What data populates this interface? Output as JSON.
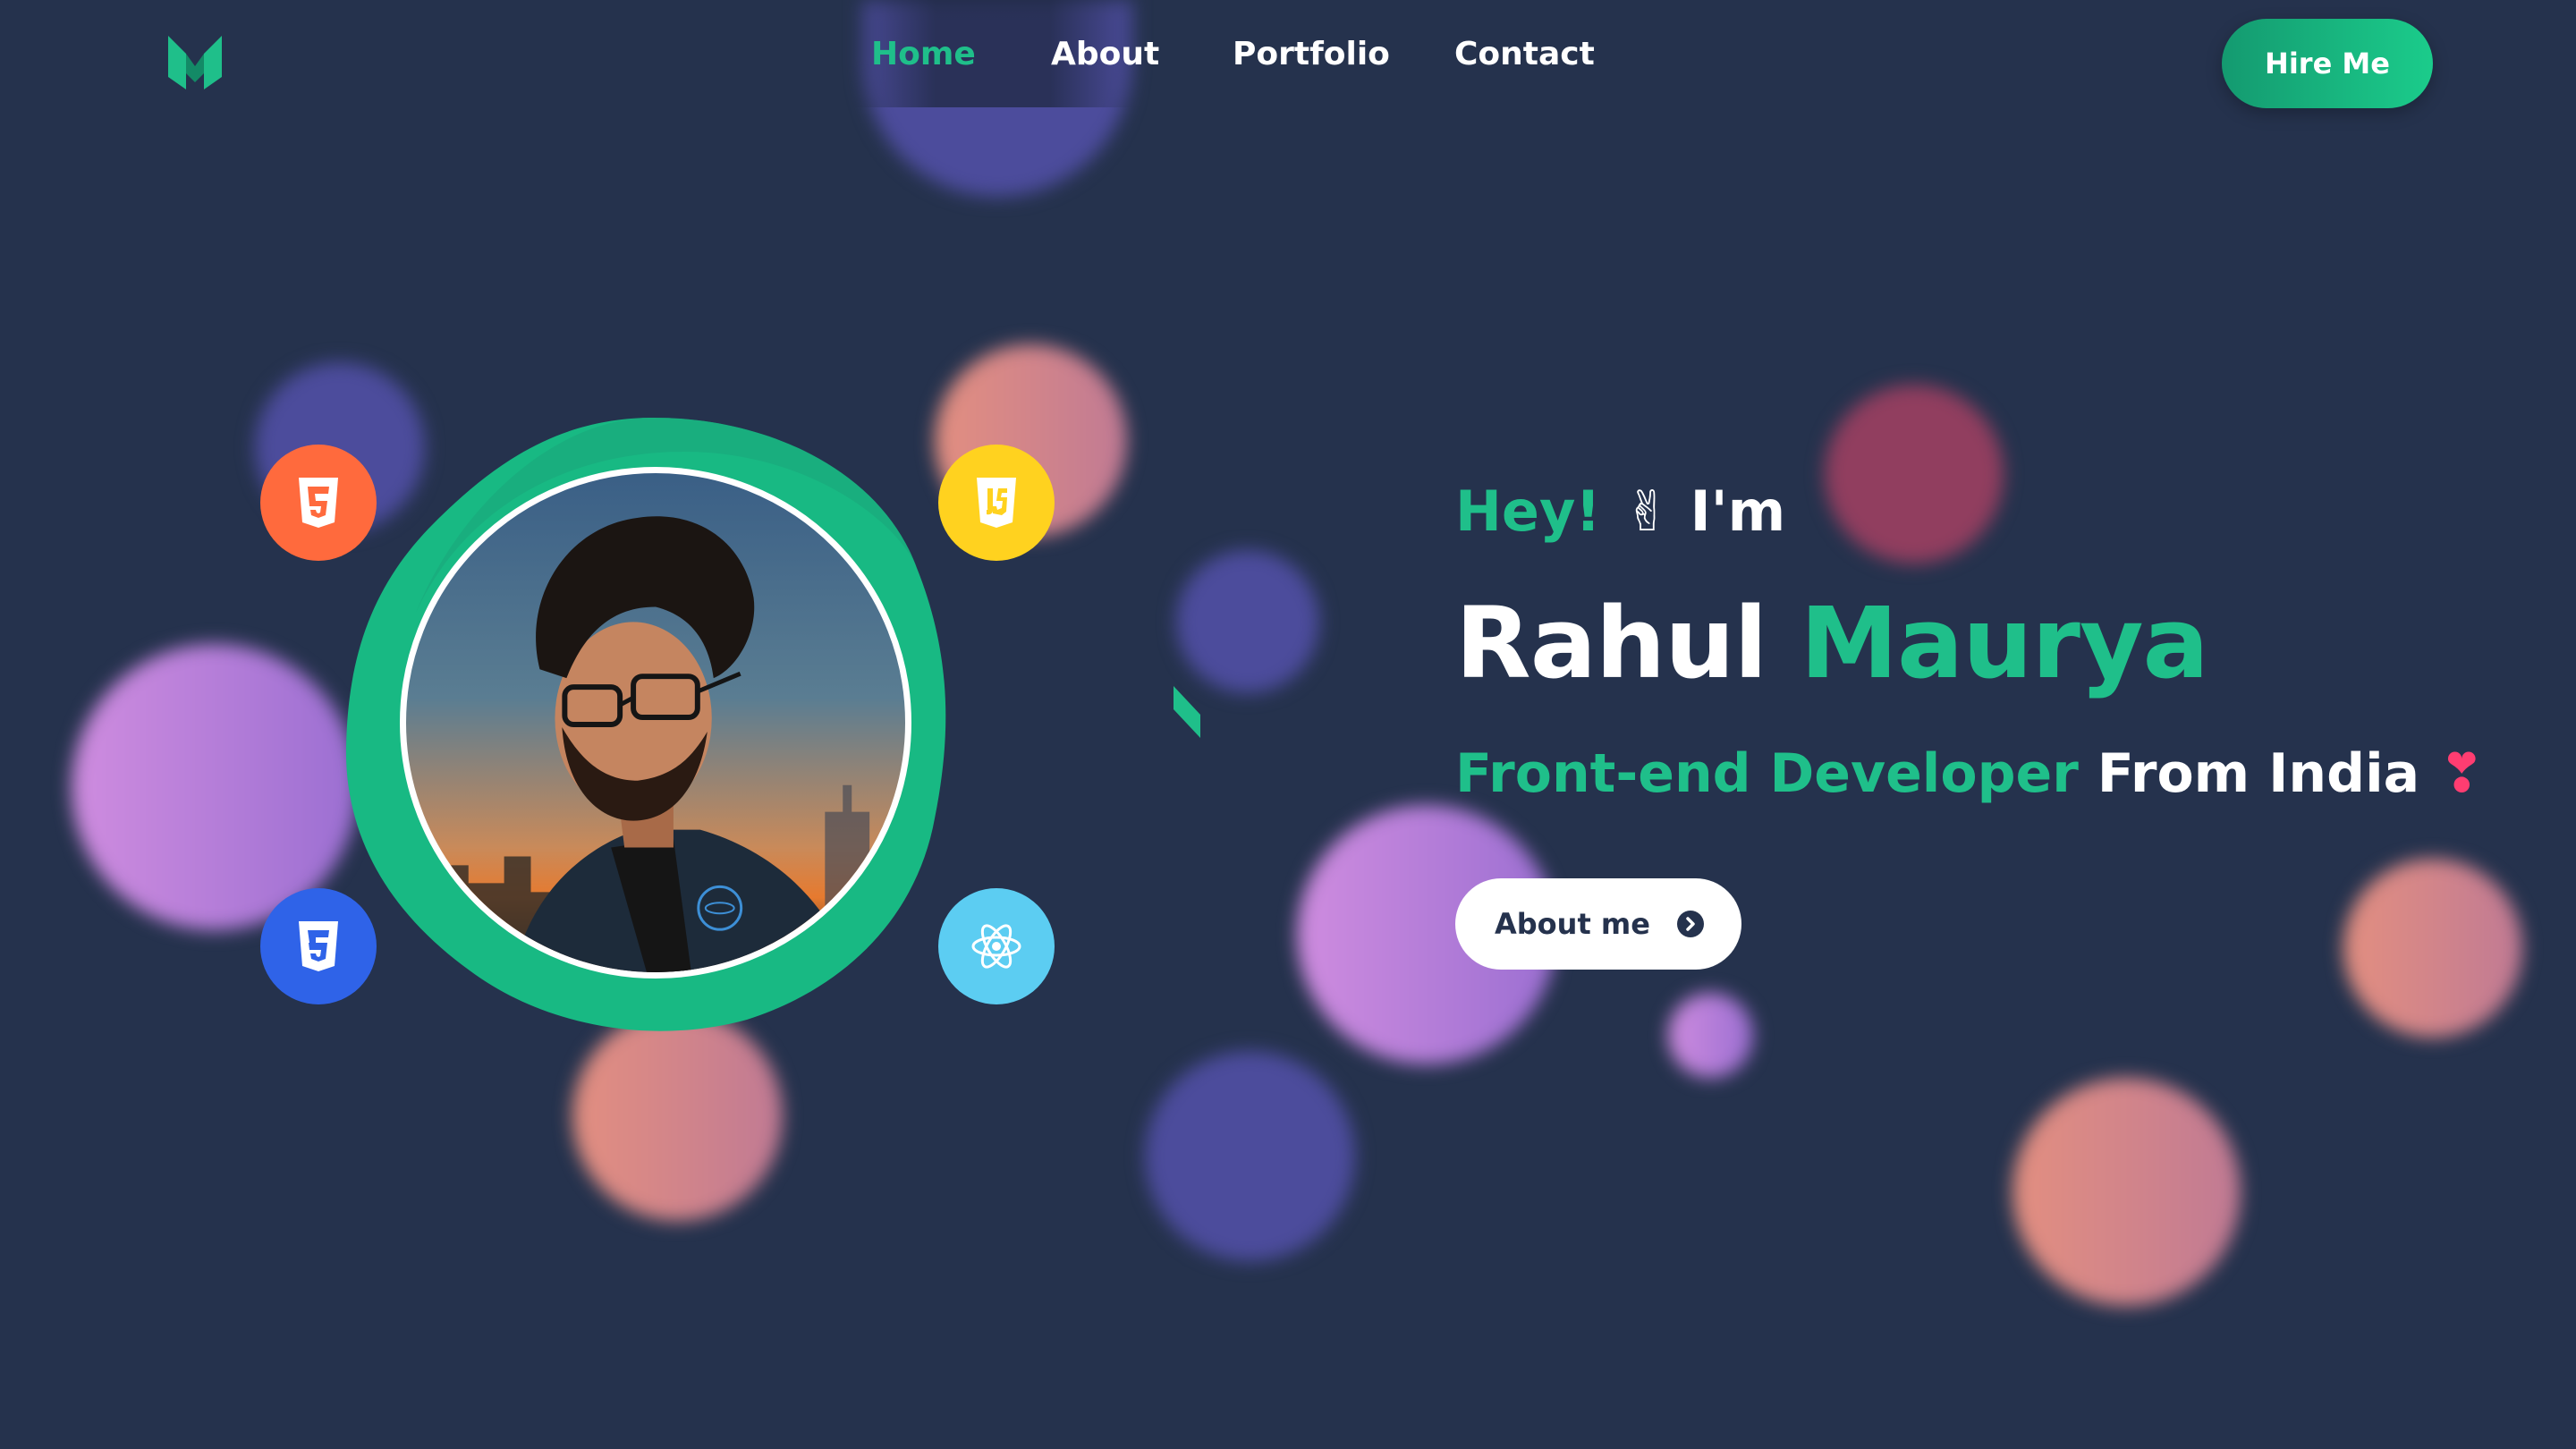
{
  "nav": {
    "logo": "M-logo-icon",
    "links": [
      {
        "label": "Home",
        "active": true
      },
      {
        "label": "About",
        "active": false
      },
      {
        "label": "Portfolio",
        "active": false
      },
      {
        "label": "Contact",
        "active": false
      }
    ],
    "cta_label": "Hire Me"
  },
  "hero": {
    "greeting_word": "Hey!",
    "greeting_emoji": "✌",
    "greeting_tail": "I'm",
    "first_name": "Rahul",
    "last_name": "Maurya",
    "role_highlight": "Front-end Developer",
    "role_tail": "From India",
    "heart_emoji": "❣",
    "about_button_label": "About me"
  },
  "tech_badges": [
    {
      "icon": "html5-icon",
      "color": "#ff6a3d"
    },
    {
      "icon": "javascript-icon",
      "color": "#ffd21f"
    },
    {
      "icon": "css3-icon",
      "color": "#2f63e8"
    },
    {
      "icon": "react-icon",
      "color": "#5ccdf2"
    }
  ],
  "colors": {
    "background": "#25324d",
    "accent": "#1fbf8a",
    "text": "#ffffff"
  }
}
